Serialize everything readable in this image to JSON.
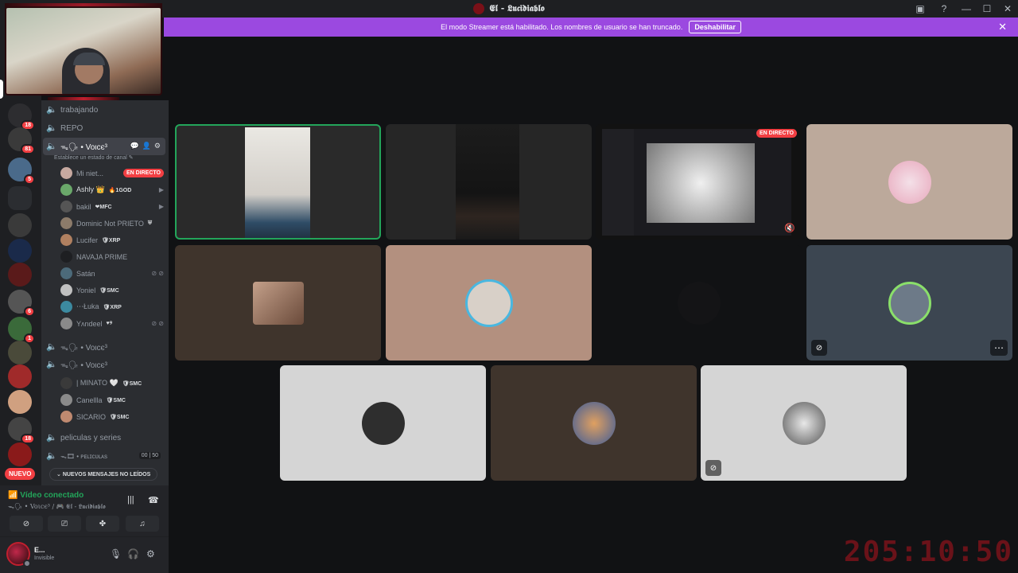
{
  "window": {
    "title": "𝕰𝖑 - 𝕷𝖚𝖈𝖎𝖉𝖎𝖆𝖇𝖑𝖔",
    "title_icon": "discord-icon",
    "controls": [
      "inbox-icon",
      "help-icon",
      "minimize-icon",
      "maximize-icon",
      "close-icon"
    ]
  },
  "banner": {
    "text": "El modo Streamer está habilitado. Los nombres de usuario se han truncado.",
    "button": "Deshabilitar"
  },
  "servers": [
    {
      "badge": "18"
    },
    {
      "badge": "81"
    },
    {
      "badge": "5"
    },
    {
      "badge": ""
    },
    {
      "badge": ""
    },
    {
      "badge": ""
    },
    {
      "badge": ""
    },
    {
      "badge": "6"
    },
    {
      "badge": "1"
    },
    {
      "badge": ""
    },
    {
      "badge": ""
    },
    {
      "badge": ""
    },
    {
      "badge": "18"
    },
    {
      "badge": ""
    }
  ],
  "nuevo_label": "NUEVO",
  "channels": {
    "text_channels": [
      "trabajando",
      "REPO"
    ],
    "active_voice": {
      "name": "ᯓ🗣 • Voιcє³",
      "status_placeholder": "Establece un estado de canal ✎",
      "users": [
        {
          "name": "Mi niet...",
          "badge": "EN DIRECTO",
          "color": "#c7a9a0"
        },
        {
          "name": "Ashly 👑",
          "tag": "🔥1GOD",
          "right": "▶",
          "color": "#6aa86a"
        },
        {
          "name": "bakil",
          "tag": "❤MFC",
          "right": "",
          "color": "#555"
        },
        {
          "name": "Dominic Not PRIETO",
          "tag": "⛨",
          "right": "",
          "color": "#8c7b6a"
        },
        {
          "name": "Lucifer",
          "tag": "🛡XRP",
          "right": "",
          "color": "#b08060"
        },
        {
          "name": "NAVAJA PRIME",
          "tag": "",
          "right": "",
          "color": "#1e1f22"
        },
        {
          "name": "Satán",
          "tag": "",
          "right": "⊘ ⊘",
          "color": "#4c6a7a"
        },
        {
          "name": "Yoniel",
          "tag": "🛡SMC",
          "right": "",
          "color": "#c0c0c0"
        },
        {
          "name": "⋯Łuka",
          "tag": "🛡XRP",
          "right": "",
          "color": "#3c8aa0"
        },
        {
          "name": "Yʌndeel",
          "tag": "♥୨",
          "right": "⊘ ⊘",
          "color": "#8a8a8a"
        }
      ]
    },
    "voice2": {
      "name": "ᯓ🗣 • Voιcє³"
    },
    "voice3": {
      "name": "ᯓ🗣 • Voιcє³",
      "users": [
        {
          "name": "| MINATO 🤍",
          "tag": "🛡SMC",
          "color": "#3a3a3a"
        },
        {
          "name": "Canellla",
          "tag": "🛡SMC",
          "color": "#8a8a8a"
        },
        {
          "name": "SICARIO",
          "tag": "🛡SMC",
          "color": "#c08a70"
        }
      ]
    },
    "peliculas": "peliculas y series",
    "peliculas2": {
      "name": "ᯓ🎞 • ᴘᴇʟɪᴄᴜʟᴀs",
      "count": "00 | 50"
    },
    "unread_button": "NUEVOS MENSAJES NO LEÍDOS"
  },
  "voice_panel": {
    "status": "Vídeo conectado",
    "location": "ᯓ🗣 • Voιcє³ / 🎮 𝕰𝖑 - 𝕷𝖚𝖈𝖎𝖉𝖎𝖆𝖇𝖑𝖔",
    "buttons": [
      "camera-off-icon",
      "screen-share-icon",
      "activities-icon",
      "soundboard-icon"
    ]
  },
  "user_panel": {
    "name": "E...",
    "status": "Invisible"
  },
  "tiles": [
    {
      "bg": "#2a2a2a",
      "selected": true,
      "kind": "video-room"
    },
    {
      "bg": "#262626",
      "kind": "video-dark"
    },
    {
      "bg": "#121212",
      "kind": "screen",
      "badge": "EN DIRECTO"
    },
    {
      "bg": "#bca99b",
      "kind": "avatar",
      "avatar_color": "#e8b8c8"
    },
    {
      "bg": "#3f342c",
      "kind": "avatar",
      "avatar_color": "#c4a08a"
    },
    {
      "bg": "#b3907f",
      "kind": "avatar",
      "avatar_color": "#d8d0c8"
    },
    {
      "bg": "#111214",
      "kind": "empty"
    },
    {
      "bg": "#3c4651",
      "kind": "avatar",
      "avatar_color": "#6d7a88"
    },
    {
      "bg": "#d5d5d5",
      "kind": "avatar",
      "avatar_color": "#2e2e2e"
    },
    {
      "bg": "#3f342c",
      "kind": "avatar",
      "avatar_color": "#b0735a"
    },
    {
      "bg": "#d5d5d5",
      "kind": "avatar",
      "avatar_color": "#888"
    }
  ],
  "timer": "205:10:50"
}
